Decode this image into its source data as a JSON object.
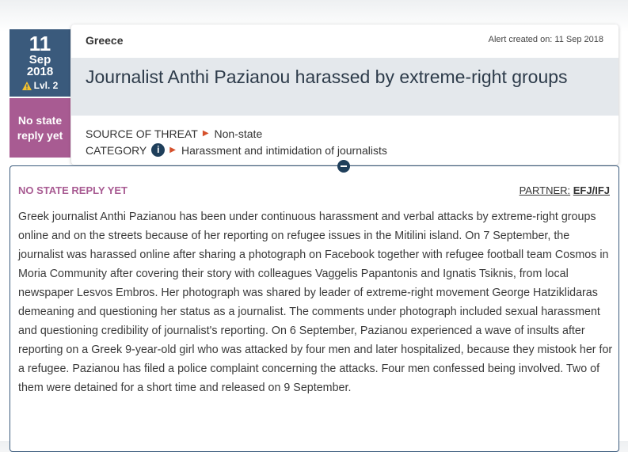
{
  "date": {
    "day": "11",
    "month": "Sep",
    "year": "2018",
    "level": "Lvl. 2"
  },
  "state_reply": {
    "label": "No state reply yet"
  },
  "alert": {
    "country": "Greece",
    "created": "Alert created on: 11 Sep 2018",
    "title": "Journalist Anthi Pazianou harassed by extreme-right groups",
    "source_key": "SOURCE OF THREAT",
    "source_value": "Non-state",
    "category_key": "CATEGORY",
    "category_value": "Harassment and intimidation of journalists"
  },
  "panel": {
    "status": "NO STATE REPLY YET",
    "partner_key": "PARTNER:",
    "partner_value": "EFJ/IFJ",
    "body": "Greek journalist Anthi Pazianou has been under continuous harassment and verbal attacks by extreme-right groups online and on the streets because of her reporting on refugee issues in the Mitilini island. On 7 September, the journalist was harassed online after sharing a photograph on Facebook together with refugee football team Cosmos in Moria Community after covering their story with colleagues Vaggelis Papantonis and Ignatis Tsiknis, from local newspaper Lesvos Embros. Her photograph was shared by leader of extreme-right movement George Hatziklidaras demeaning and questioning her status as a journalist. The comments under photograph included sexual harassment and questioning credibility of journalist's reporting. On 6 September, Pazianou experienced a wave of insults after reporting on a Greek 9-year-old girl who was attacked by four men and later hospitalized, because they mistook her for a refugee. Pazianou has filed a police complaint concerning the attacks. Four men confessed being involved. Two of them were detained for a short time and released on 9 September."
  },
  "colors": {
    "date_bg": "#3a5a7c",
    "state_bg": "#a85b92",
    "accent_arrow": "#d5502b",
    "title_band": "#e4e8ec"
  },
  "icons": {
    "warning": "warning-icon",
    "info": "info-icon",
    "arrow": "arrow-right-icon",
    "collapse": "collapse-icon"
  }
}
